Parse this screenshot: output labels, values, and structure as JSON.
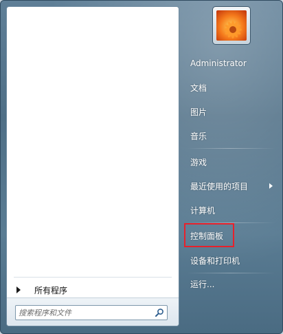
{
  "start_menu": {
    "left": {
      "all_programs_label": "所有程序",
      "search": {
        "placeholder": "搜索程序和文件"
      }
    },
    "right": {
      "user_name": "Administrator",
      "items": [
        {
          "label": "文档"
        },
        {
          "label": "图片"
        },
        {
          "label": "音乐"
        },
        {
          "label": "游戏"
        },
        {
          "label": "最近使用的项目",
          "has_submenu": true
        },
        {
          "label": "计算机"
        },
        {
          "label": "控制面板",
          "highlighted": true
        },
        {
          "label": "设备和打印机"
        },
        {
          "label": "运行..."
        }
      ]
    },
    "colors": {
      "highlight_border": "#e8202a",
      "right_text": "#ffffff"
    },
    "icons": [
      "search-icon",
      "submenu-arrow-icon",
      "all-programs-arrow-icon",
      "user-avatar"
    ]
  }
}
